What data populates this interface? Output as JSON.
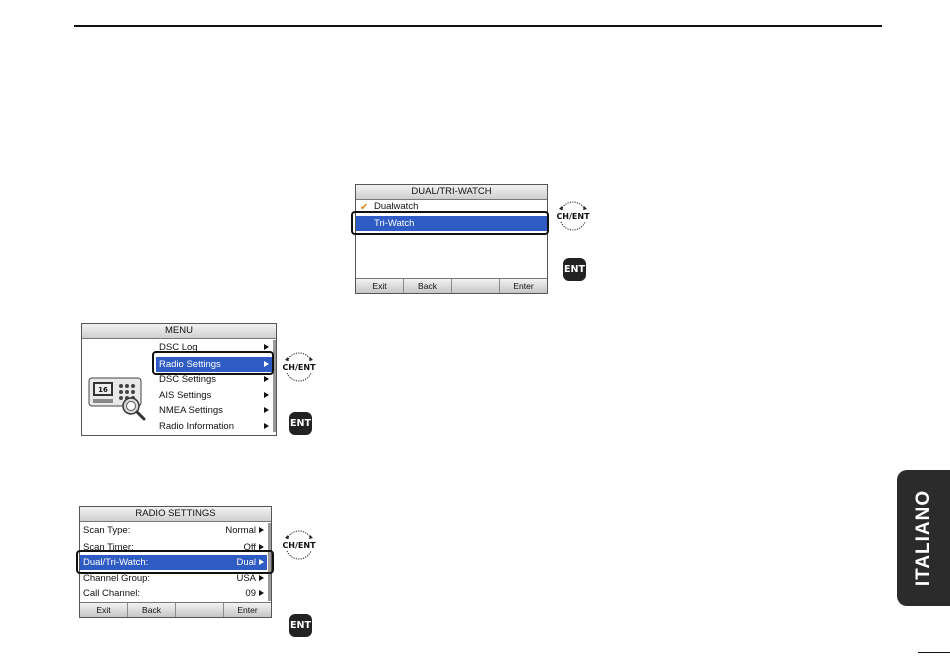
{
  "side_tab": {
    "label": "ITALIANO"
  },
  "dual_tri_screen": {
    "title": "DUAL/TRI-WATCH",
    "items": [
      {
        "label": "Dualwatch",
        "checked": true
      },
      {
        "label": "Tri-Watch",
        "selected": true
      }
    ],
    "softkeys": [
      "Exit",
      "Back",
      "",
      "Enter"
    ]
  },
  "menu_screen": {
    "title": "MENU",
    "items": [
      {
        "label": "DSC Log"
      },
      {
        "label": "Radio Settings",
        "selected": true
      },
      {
        "label": "DSC Settings"
      },
      {
        "label": "AIS Settings"
      },
      {
        "label": "NMEA Settings"
      },
      {
        "label": "Radio Information"
      }
    ],
    "device_channel": "16"
  },
  "radio_settings_screen": {
    "title": "RADIO SETTINGS",
    "items": [
      {
        "label": "Scan Type:",
        "value": "Normal"
      },
      {
        "label": "Scan Timer:",
        "value": "Off"
      },
      {
        "label": "Dual/Tri-Watch:",
        "value": "Dual",
        "selected": true
      },
      {
        "label": "Channel Group:",
        "value": "USA"
      },
      {
        "label": "Call Channel:",
        "value": "09"
      }
    ],
    "softkeys": [
      "Exit",
      "Back",
      "",
      "Enter"
    ]
  },
  "icons": {
    "dial_label": "CH/ENT",
    "ent_label": "ENT"
  },
  "colors": {
    "selection": "#2f5cc4",
    "checkmark": "#e08a1e",
    "side_tab": "#2b2b2b"
  }
}
